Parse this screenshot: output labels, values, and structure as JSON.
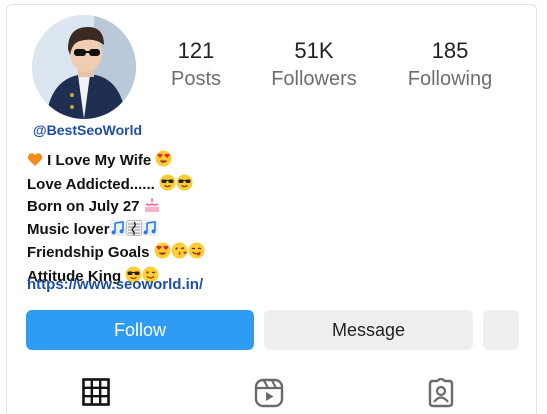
{
  "profile": {
    "handle": "@BestSeoWorld",
    "stats": [
      {
        "value": "121",
        "label": "Posts"
      },
      {
        "value": "51K",
        "label": "Followers"
      },
      {
        "value": "185",
        "label": "Following"
      }
    ],
    "bio": [
      {
        "text": "I Love My Wife",
        "emoji_before": [
          "orange-heart"
        ],
        "emoji_after": [
          "heart-eyes"
        ]
      },
      {
        "text": "Love Addicted......",
        "emoji_before": [],
        "emoji_after": [
          "sunglasses",
          "sunglasses"
        ]
      },
      {
        "text": "Born on July 27",
        "emoji_before": [],
        "emoji_after": [
          "birthday-cake"
        ]
      },
      {
        "text": "Music lover",
        "emoji_before": [],
        "emoji_after": [
          "music-notes",
          "musical-score",
          "music-notes"
        ]
      },
      {
        "text": "Friendship Goals",
        "emoji_before": [],
        "emoji_after": [
          "heart-eyes",
          "kissing-heart",
          "yum"
        ]
      },
      {
        "text": "Attitude King",
        "emoji_before": [],
        "emoji_after": [
          "sunglasses",
          "winking"
        ]
      }
    ],
    "link": "https://www.seoworld.in/"
  },
  "actions": {
    "follow_label": "Follow",
    "message_label": "Message"
  },
  "tabs": [
    {
      "icon": "grid-icon"
    },
    {
      "icon": "reels-icon"
    },
    {
      "icon": "tagged-icon"
    }
  ],
  "colors": {
    "follow_bg": "#2d9cf2",
    "secondary_btn_bg": "#efefef",
    "link": "#1f4ea8",
    "stat_label": "#6e6e6e"
  }
}
